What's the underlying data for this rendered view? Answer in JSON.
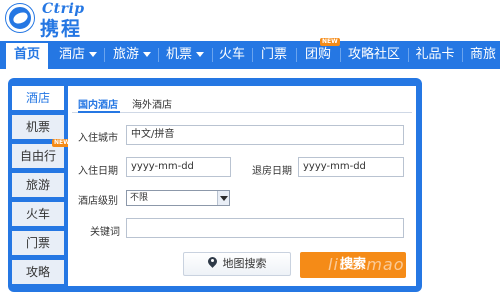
{
  "logo": {
    "en": "Ctrip",
    "cn": "携程"
  },
  "nav": {
    "items": [
      {
        "label": "首页"
      },
      {
        "label": "酒店"
      },
      {
        "label": "旅游"
      },
      {
        "label": "机票"
      },
      {
        "label": "火车"
      },
      {
        "label": "门票"
      },
      {
        "label": "团购",
        "badge": "NEW"
      },
      {
        "label": "攻略社区"
      },
      {
        "label": "礼品卡"
      },
      {
        "label": "商旅"
      }
    ]
  },
  "side": {
    "items": [
      {
        "label": "酒店"
      },
      {
        "label": "机票"
      },
      {
        "label": "自由行",
        "badge": "NEW"
      },
      {
        "label": "旅游"
      },
      {
        "label": "火车"
      },
      {
        "label": "门票"
      },
      {
        "label": "攻略"
      }
    ]
  },
  "tabs": [
    {
      "label": "国内酒店"
    },
    {
      "label": "海外酒店"
    }
  ],
  "form": {
    "city_label": "入住城市",
    "city_value": "中文/拼音",
    "checkin_label": "入住日期",
    "checkin_value": "yyyy-mm-dd",
    "checkout_label": "退房日期",
    "checkout_value": "yyyy-mm-dd",
    "level_label": "酒店级别",
    "level_value": "不限",
    "keyword_label": "关键词",
    "keyword_value": ""
  },
  "buttons": {
    "map_search": "地图搜索",
    "search": "搜索"
  },
  "watermark": "liuelmao",
  "colors": {
    "brand_blue": "#2577e3",
    "accent_orange": "#f58b17"
  }
}
